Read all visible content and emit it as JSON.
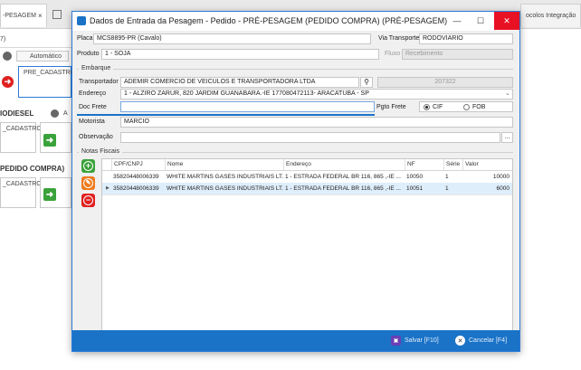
{
  "background": {
    "tabs": [
      {
        "label": "-PESAGEM"
      },
      {
        "label": "ocolos Integração"
      }
    ],
    "left_rows": [
      {
        "section": "",
        "automatic": "Automático",
        "card_title": "PRE_CADASTRO"
      },
      {
        "section": "IODIESEL",
        "automatic": "A",
        "card_title": "_CADASTRO"
      },
      {
        "section": "PEDIDO COMPRA)",
        "automatic": "",
        "card_title": "_CADASTRO"
      }
    ],
    "corner_text": "7)"
  },
  "dialog": {
    "title": "Dados de Entrada da Pesagem - Pedido - PRÉ-PESAGEM (PEDIDO COMPRA) (PRÉ-PESAGEM)",
    "placa": {
      "label": "Placa",
      "value": "MCS8895-PR (Cavalo)"
    },
    "via_transporte": {
      "label": "Via Transporte",
      "value": "RODOVIARIO"
    },
    "produto": {
      "label": "Produto",
      "value": "1 - SOJA"
    },
    "fluxo": {
      "label": "Fluxo",
      "value": "Recebimento"
    },
    "embarque": {
      "group_label": "Embarque",
      "transportador": {
        "label": "Transportador",
        "value": "ADEMIR COMERCIO DE VEICULOS E TRANSPORTADORA LTDA",
        "code": "207322"
      },
      "endereco": {
        "label": "Endereço",
        "value": "1 - ALZIRO ZARUR, 820  JARDIM GUANABARA.-IE 177080472113- ARACATUBA - SP"
      },
      "doc_frete": {
        "label": "Doc Frete",
        "value": ""
      },
      "pgto_frete": {
        "label": "Pgto Frete",
        "options": [
          "CIF",
          "FOB"
        ],
        "selected": "CIF"
      },
      "motorista": {
        "label": "Motorista",
        "value": "MARCIO"
      },
      "observacao": {
        "label": "Observação",
        "value": "",
        "more": "..."
      }
    },
    "notas": {
      "group_label": "Notas Fiscais",
      "columns": [
        "CPF/CNPJ",
        "Nome",
        "Endereço",
        "NF",
        "Série",
        "Valor"
      ],
      "rows": [
        {
          "cnpj": "35820448006339",
          "nome": "WHITE MARTINS GASES INDUSTRIAIS LT...",
          "endereco": "1 - ESTRADA FEDERAL BR 116, 865 ,-IE ...",
          "nf": "10050",
          "serie": "1",
          "valor": "10000",
          "selected": false
        },
        {
          "cnpj": "35820448006339",
          "nome": "WHITE MARTINS GASES INDUSTRIAIS LT...",
          "endereco": "1 - ESTRADA FEDERAL BR 116, 865 ,-IE ...",
          "nf": "10051",
          "serie": "1",
          "valor": "6000",
          "selected": true
        }
      ]
    },
    "buttons": {
      "salvar": "Salvar [F10]",
      "cancelar": "Cancelar [F4]"
    },
    "colors": {
      "accent": "#1a73c7",
      "add": "#3aa23a",
      "edit": "#ef7b1d",
      "remove": "#e02020",
      "close": "#e81123"
    }
  }
}
